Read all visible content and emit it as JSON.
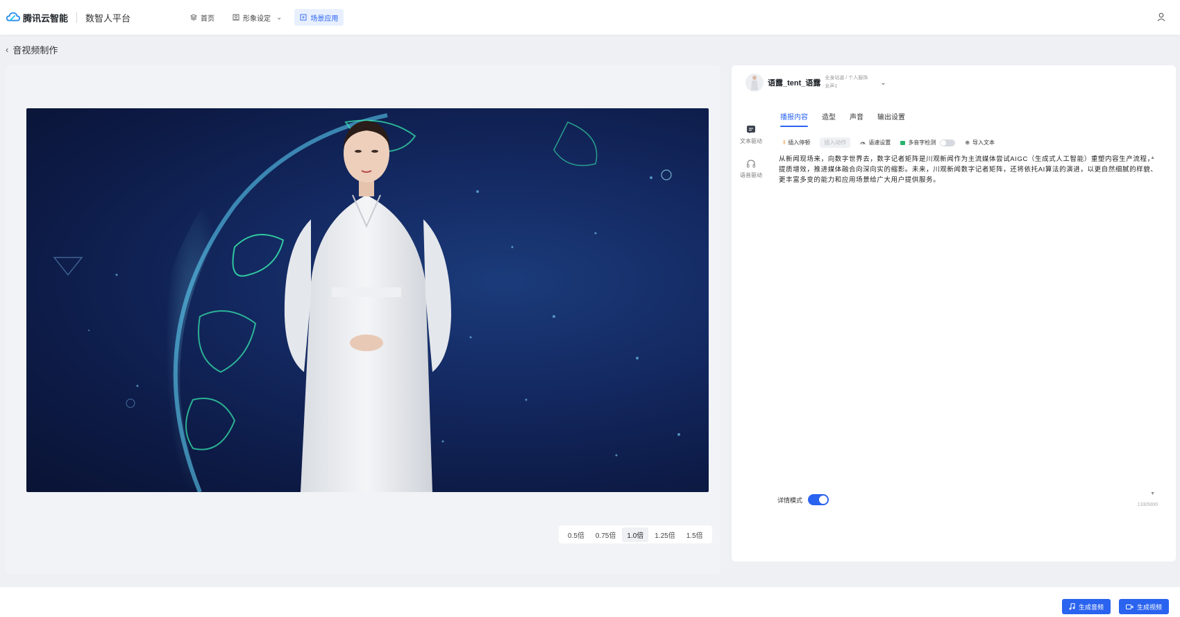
{
  "brand": {
    "name": "腾讯云智能",
    "product": "数智人平台"
  },
  "nav": [
    {
      "label": "首页",
      "icon": "layers-icon"
    },
    {
      "label": "形象设定",
      "icon": "portrait-icon"
    },
    {
      "label": "场景应用",
      "icon": "scene-icon"
    }
  ],
  "breadcrumb": {
    "title": "音视频制作"
  },
  "speeds": [
    "0.5倍",
    "0.75倍",
    "1.0倍",
    "1.25倍",
    "1.5倍"
  ],
  "speed_selected": "1.0倍",
  "avatar": {
    "name": "语露_tent_语露",
    "meta1": "全身站姿 / 个人服饰",
    "meta2": "女声1"
  },
  "side_tools": {
    "text_drive": "文本驱动",
    "voice_drive": "语音驱动"
  },
  "tabs": [
    "播报内容",
    "造型",
    "声音",
    "输出设置"
  ],
  "toolbar": {
    "insert_pause": "插入停顿",
    "insert_action": "插入动作",
    "speed_setting": "语速设置",
    "polyphone": "多音字检测",
    "import_text": "导入文本"
  },
  "script": "从新闻现场来，向数字世界去，数字记者矩阵是川观新闻作为主流媒体尝试AIGC（生成式人工智能）重塑内容生产流程，提质增效，推进媒体融合向深向实的缩影。未来，川观新闻数字记者矩阵，还将依托AI算法的演进，以更自然细腻的样貌、更丰富多变的能力和应用场景给广大用户提供服务。",
  "counter": "133/5000",
  "detail_mode": "详情模式",
  "buttons": {
    "gen_audio": "生成音频",
    "gen_video": "生成视频"
  },
  "colors": {
    "accent": "#2a63ef"
  }
}
